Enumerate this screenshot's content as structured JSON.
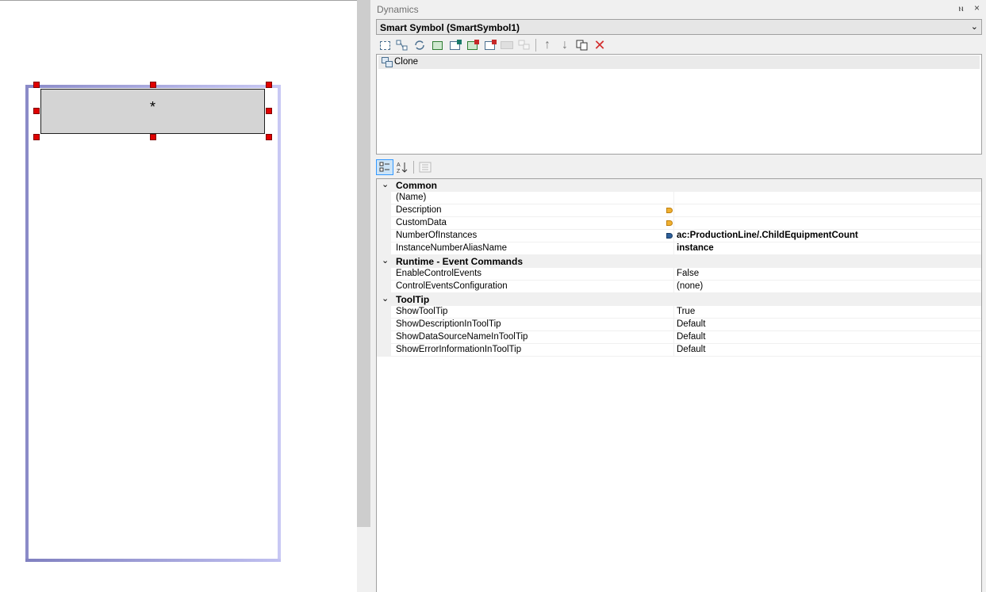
{
  "canvas": {
    "clone_text": "*"
  },
  "panel": {
    "title": "Dynamics",
    "pin_glyph": "ⲛ",
    "close_glyph": "×",
    "symbol_selector": "Smart Symbol (SmartSymbol1)",
    "chevron": "⌄"
  },
  "toolbar_icons": [
    "select-all-icon",
    "connect-icon",
    "refresh-icon",
    "add-green-icon",
    "add-teal-icon",
    "add-red-icon",
    "remove-icon",
    "rename-icon",
    "link-icon",
    "move-up-icon",
    "move-down-icon",
    "copy-icon",
    "delete-icon"
  ],
  "tree": {
    "items": [
      {
        "label": "Clone",
        "icon": "clone-icon"
      }
    ]
  },
  "grid_toolbar": {
    "icons": [
      "categorized-icon",
      "alphabetical-icon",
      "property-pages-icon"
    ]
  },
  "property_grid": {
    "categories": [
      {
        "name": "Common",
        "rows": [
          {
            "name": "(Name)",
            "value": "",
            "tag": ""
          },
          {
            "name": "Description",
            "value": "",
            "tag": "orange"
          },
          {
            "name": "CustomData",
            "value": "",
            "tag": "orange"
          },
          {
            "name": "NumberOfInstances",
            "value": "ac:ProductionLine/.ChildEquipmentCount",
            "tag": "blue",
            "bold": true
          },
          {
            "name": "InstanceNumberAliasName",
            "value": "instance",
            "tag": "",
            "bold": true
          }
        ]
      },
      {
        "name": "Runtime - Event Commands",
        "rows": [
          {
            "name": "EnableControlEvents",
            "value": "False",
            "tag": ""
          },
          {
            "name": "ControlEventsConfiguration",
            "value": "(none)",
            "tag": ""
          }
        ]
      },
      {
        "name": "ToolTip",
        "rows": [
          {
            "name": "ShowToolTip",
            "value": "True",
            "tag": ""
          },
          {
            "name": "ShowDescriptionInToolTip",
            "value": "Default",
            "tag": ""
          },
          {
            "name": "ShowDataSourceNameInToolTip",
            "value": "Default",
            "tag": ""
          },
          {
            "name": "ShowErrorInformationInToolTip",
            "value": "Default",
            "tag": ""
          }
        ]
      }
    ]
  },
  "colors": {
    "handle": "#e00000",
    "frame_left": "#8b8bc8",
    "frame_right": "#c8c8f4",
    "delete_red": "#d32f2f"
  }
}
